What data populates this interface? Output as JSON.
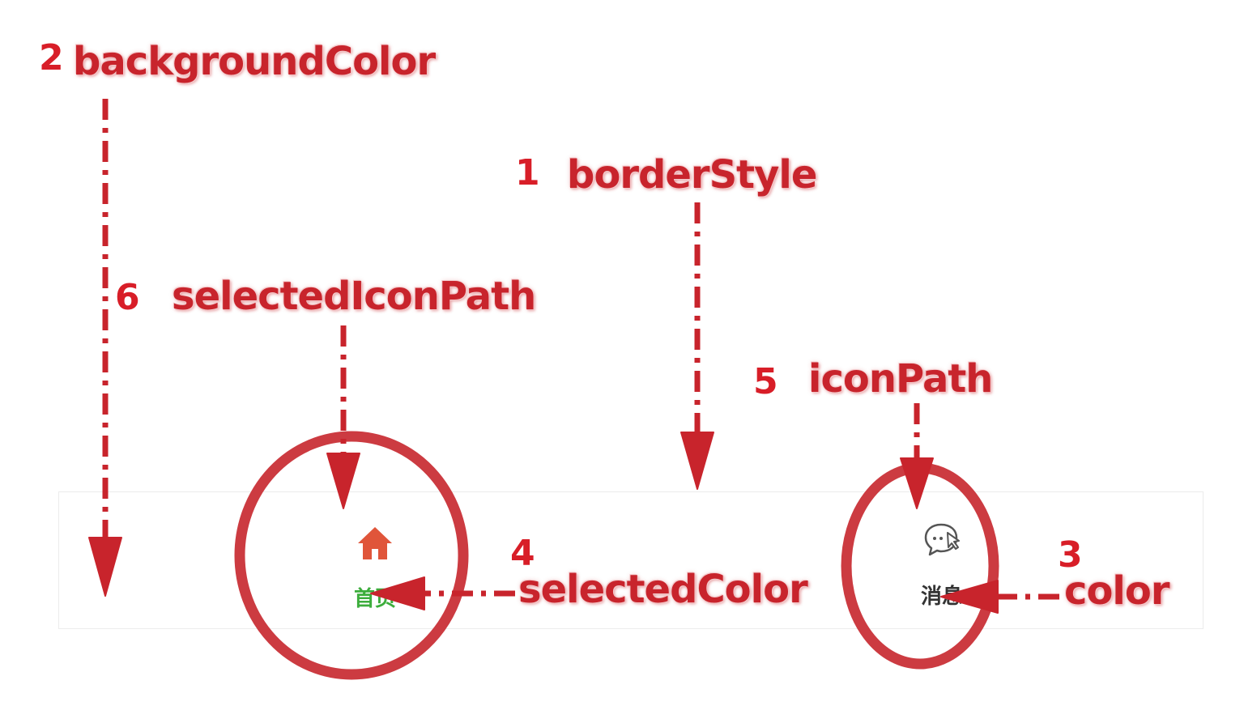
{
  "annotations": [
    {
      "number": "2",
      "label": "backgroundColor"
    },
    {
      "number": "1",
      "label": "borderStyle"
    },
    {
      "number": "6",
      "label": "selectedIconPath"
    },
    {
      "number": "5",
      "label": "iconPath"
    },
    {
      "number": "4",
      "label": "selectedColor"
    },
    {
      "number": "3",
      "label": "color"
    }
  ],
  "tabbar": {
    "tabs": [
      {
        "label": "首页",
        "icon": "home-icon",
        "color": "#3cad3c",
        "icon_color": "#e0553a",
        "selected": true
      },
      {
        "label": "消息",
        "icon": "chat-bubble-icon",
        "color": "#333333",
        "icon_color": "#555555",
        "selected": false
      }
    ]
  },
  "colors": {
    "annotation": "#c8242c",
    "circle": "#cc3b41",
    "tabbar_border": "#ececec"
  }
}
